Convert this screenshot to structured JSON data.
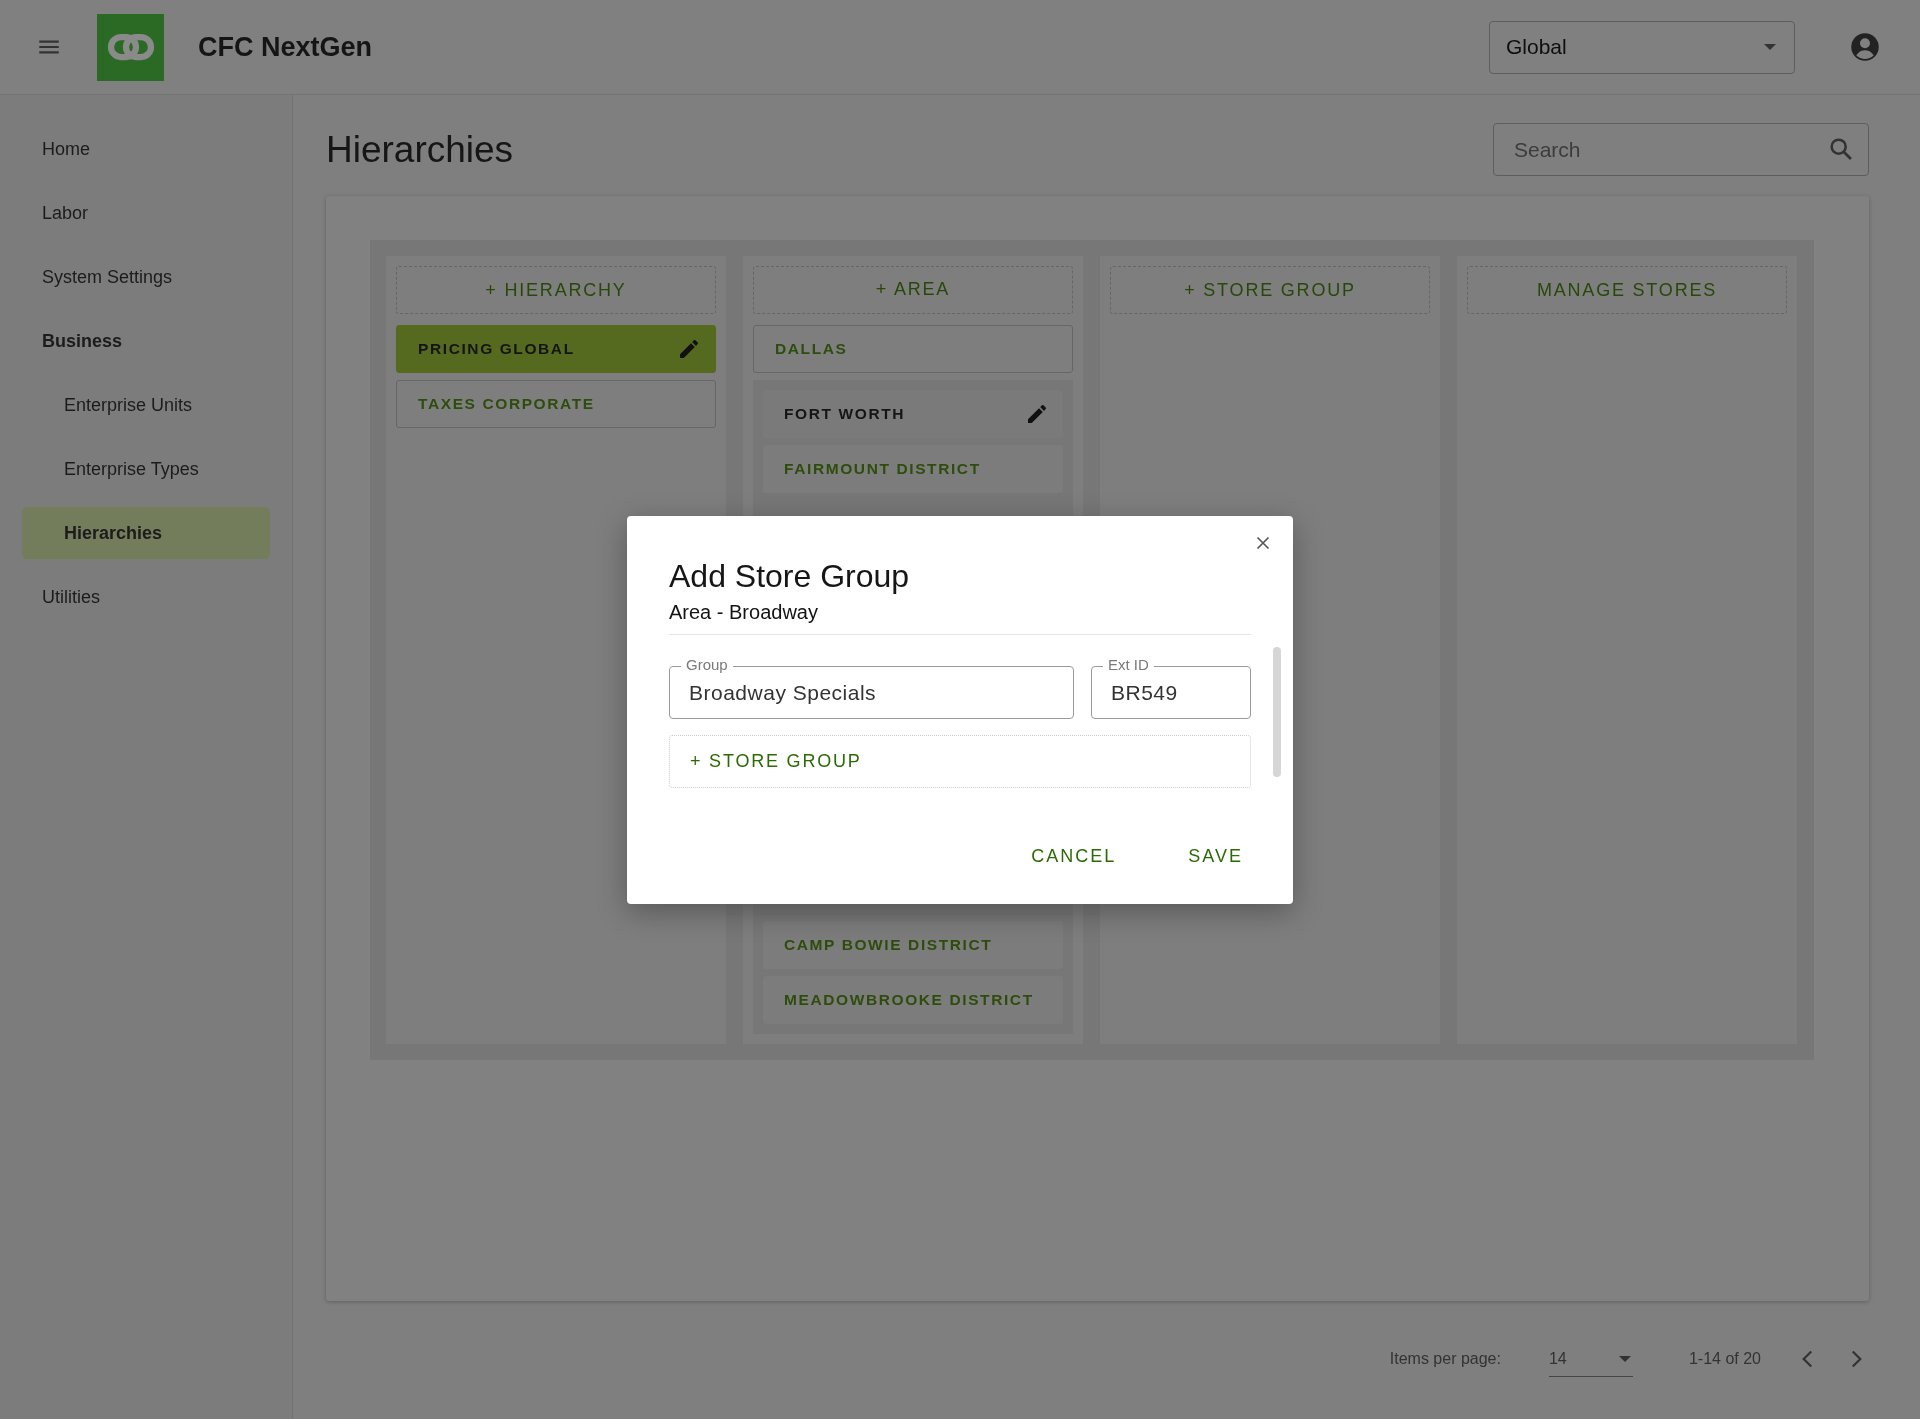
{
  "header": {
    "app_title": "CFC NextGen",
    "scope_select": {
      "value": "Global"
    }
  },
  "sidebar": {
    "items": [
      {
        "label": "Home",
        "kind": "top",
        "selected": false
      },
      {
        "label": "Labor",
        "kind": "top",
        "selected": false
      },
      {
        "label": "System Settings",
        "kind": "top",
        "selected": false
      },
      {
        "label": "Business",
        "kind": "section",
        "selected": false
      },
      {
        "label": "Enterprise Units",
        "kind": "sub",
        "selected": false
      },
      {
        "label": "Enterprise Types",
        "kind": "sub",
        "selected": false
      },
      {
        "label": "Hierarchies",
        "kind": "sub",
        "selected": true
      },
      {
        "label": "Utilities",
        "kind": "top",
        "selected": false
      }
    ]
  },
  "page": {
    "title": "Hierarchies",
    "search": {
      "placeholder": "Search"
    }
  },
  "columns": [
    {
      "header_button": "+ HIERARCHY",
      "items": [
        {
          "label": "PRICING GLOBAL",
          "selected": true
        },
        {
          "label": "TAXES CORPORATE",
          "selected": false
        }
      ]
    },
    {
      "header_button": "+ AREA",
      "items": [
        {
          "label": "DALLAS",
          "selected": false
        },
        {
          "label": "FORT WORTH",
          "selected": true,
          "children": [
            {
              "label": "FAIRMOUNT DISTRICT",
              "selected": false
            },
            {
              "label": "CAMP BOWIE DISTRICT",
              "selected": false
            },
            {
              "label": "MEADOWBROOKE DISTRICT",
              "selected": false
            }
          ]
        }
      ]
    },
    {
      "header_button": "+ STORE GROUP"
    },
    {
      "header_button": "MANAGE STORES"
    }
  ],
  "dialog": {
    "title": "Add Store Group",
    "subtitle": "Area - Broadway",
    "fields": [
      {
        "label": "Group",
        "value": "Broadway Specials"
      },
      {
        "label": "Ext ID",
        "value": "BR549"
      }
    ],
    "add_button": "+ STORE GROUP",
    "actions": [
      "CANCEL",
      "SAVE"
    ]
  },
  "pagination": {
    "label": "Items per page:",
    "page_size": "14",
    "range": "1-14 of 20"
  }
}
